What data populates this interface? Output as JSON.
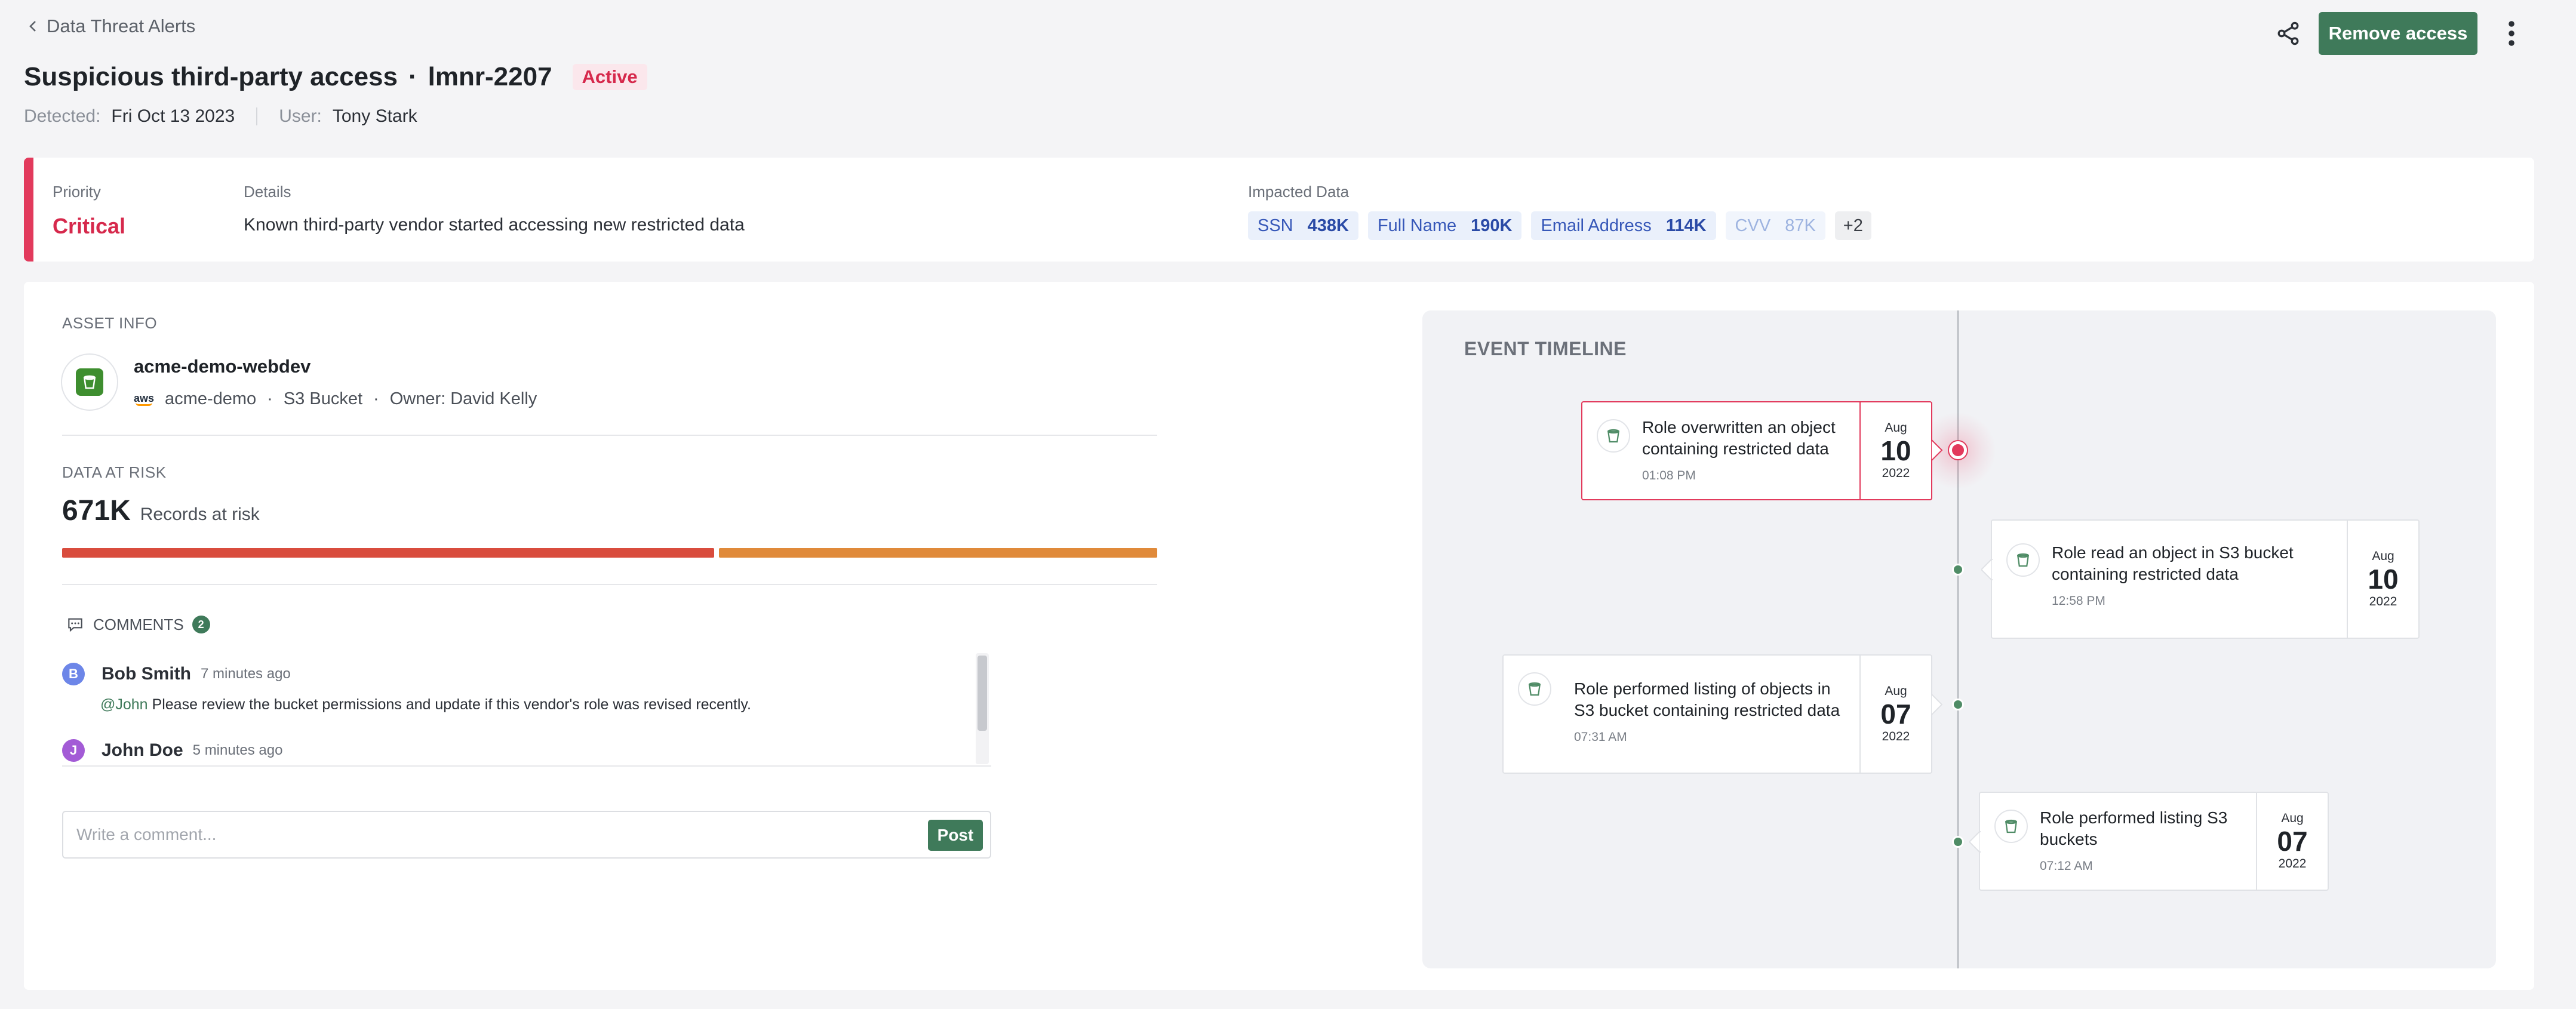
{
  "header": {
    "back_label": "Data Threat Alerts",
    "title": "Suspicious third-party access",
    "title_sep": "·",
    "alert_id": "lmnr-2207",
    "status": "Active",
    "detected_label": "Detected:",
    "detected_value": "Fri Oct 13 2023",
    "user_label": "User:",
    "user_value": "Tony Stark",
    "remove_label": "Remove access"
  },
  "summary": {
    "priority_label": "Priority",
    "priority_value": "Critical",
    "details_label": "Details",
    "details_value": "Known third-party vendor started accessing new restricted data",
    "impacted_label": "Impacted Data",
    "chips": [
      {
        "name": "SSN",
        "count": "438K"
      },
      {
        "name": "Full Name",
        "count": "190K"
      },
      {
        "name": "Email Address",
        "count": "114K"
      },
      {
        "name": "CVV",
        "count": "87K"
      }
    ],
    "more": "+2"
  },
  "asset": {
    "section_label": "ASSET INFO",
    "name": "acme-demo-webdev",
    "cloud_mark": "aws",
    "account": "acme-demo",
    "sep": "·",
    "type": "S3 Bucket",
    "owner": "Owner: David Kelly"
  },
  "data_at_risk": {
    "section_label": "DATA AT RISK",
    "value": "671K",
    "unit": "Records at risk"
  },
  "comments": {
    "section_label": "COMMENTS",
    "count": "2",
    "items": [
      {
        "initial": "B",
        "author": "Bob Smith",
        "time": "7 minutes ago",
        "mention": "@John",
        "text": " Please review the bucket permissions and update if this vendor's role was revised recently."
      },
      {
        "initial": "J",
        "author": "John Doe",
        "time": "5 minutes ago"
      }
    ],
    "placeholder": "Write a comment...",
    "post_label": "Post"
  },
  "timeline": {
    "title": "EVENT TIMELINE",
    "events": [
      {
        "title": "Role overwritten an object containing restricted data",
        "time": "01:08 PM",
        "month": "Aug",
        "day": "10",
        "year": "2022"
      },
      {
        "title": "Role read an object in S3 bucket containing restricted data",
        "time": "12:58 PM",
        "month": "Aug",
        "day": "10",
        "year": "2022"
      },
      {
        "title": "Role performed listing of objects in S3 bucket containing restricted data",
        "time": "07:31 AM",
        "month": "Aug",
        "day": "07",
        "year": "2022"
      },
      {
        "title": "Role performed listing S3 buckets",
        "time": "07:12 AM",
        "month": "Aug",
        "day": "07",
        "year": "2022"
      }
    ]
  },
  "colors": {
    "accent_green": "#3f7a5a",
    "critical_red": "#e23a5c",
    "chip_blue": "#3657b8",
    "risk_red": "#d94c3d",
    "risk_orange": "#e08a3a"
  }
}
